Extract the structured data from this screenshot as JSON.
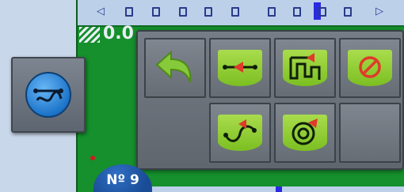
{
  "lightbar": {
    "left_arrow": "◁",
    "right_arrow": "▷",
    "segments": 10
  },
  "readout": {
    "value": "0.0"
  },
  "tool_button": {
    "icon": "path-guidance-icon"
  },
  "panel": {
    "tiles": [
      {
        "icon": "back-arrow-icon"
      },
      {
        "icon": "straight-ab-line-icon"
      },
      {
        "icon": "adaptive-curve-icon"
      },
      {
        "icon": "guidance-off-icon"
      },
      {
        "icon": "a-plus-curve-icon"
      },
      {
        "icon": "circle-pivot-icon"
      }
    ]
  },
  "badge": {
    "label": "Nº 9"
  },
  "colors": {
    "field": "#15902c",
    "icon_green": "#8fcb35",
    "accent_red": "#e03a2a",
    "panel_grey": "#6d747c",
    "blue": "#1d74c9"
  }
}
